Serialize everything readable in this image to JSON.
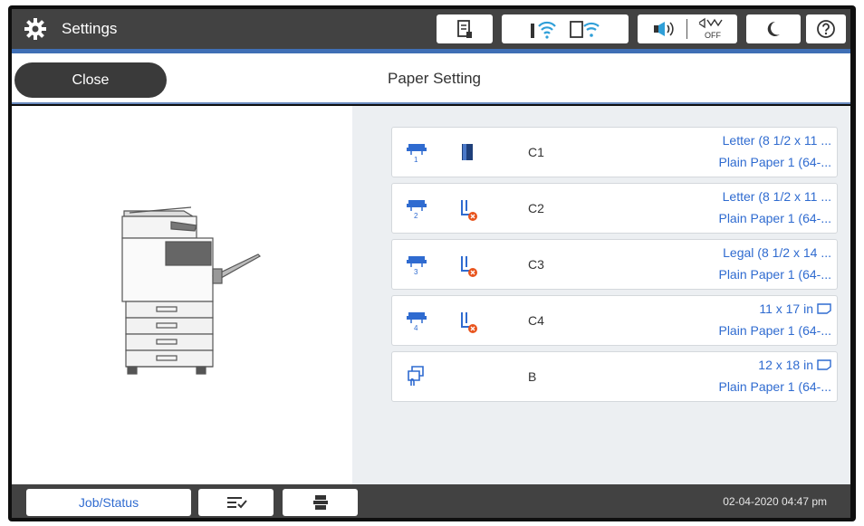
{
  "header": {
    "title": "Settings",
    "icons": [
      "gear-icon",
      "printer-status-icon",
      "wifi-icon",
      "wifi-direct-icon",
      "speaker-icon",
      "quiet-mode-off-icon",
      "sleep-icon",
      "help-icon"
    ],
    "quiet_mode_label": "OFF"
  },
  "toolbar": {
    "close_label": "Close",
    "page_title": "Paper Setting"
  },
  "trays": [
    {
      "number": "1",
      "code": "C1",
      "size": "Letter (8 1/2 x 11 ...",
      "type": "Plain Paper 1 (64-...",
      "status": "paper-loaded",
      "orientation_icon": false
    },
    {
      "number": "2",
      "code": "C2",
      "size": "Letter (8 1/2 x 11 ...",
      "type": "Plain Paper 1 (64-...",
      "status": "paper-empty",
      "orientation_icon": false
    },
    {
      "number": "3",
      "code": "C3",
      "size": "Legal (8 1/2 x 14 ...",
      "type": "Plain Paper 1 (64-...",
      "status": "paper-empty",
      "orientation_icon": false
    },
    {
      "number": "4",
      "code": "C4",
      "size": "11 x 17 in",
      "type": "Plain Paper 1 (64-...",
      "status": "paper-empty",
      "orientation_icon": true
    },
    {
      "number": "",
      "code": "B",
      "size": "12 x 18 in",
      "type": "Plain Paper 1 (64-...",
      "status": "none",
      "orientation_icon": true
    }
  ],
  "footer": {
    "job_status_label": "Job/Status",
    "datetime": "02-04-2020 04:47 pm"
  },
  "colors": {
    "bar": "#424242",
    "accent": "#3f6fb5",
    "link": "#2f6bd0",
    "error": "#e8531c"
  }
}
